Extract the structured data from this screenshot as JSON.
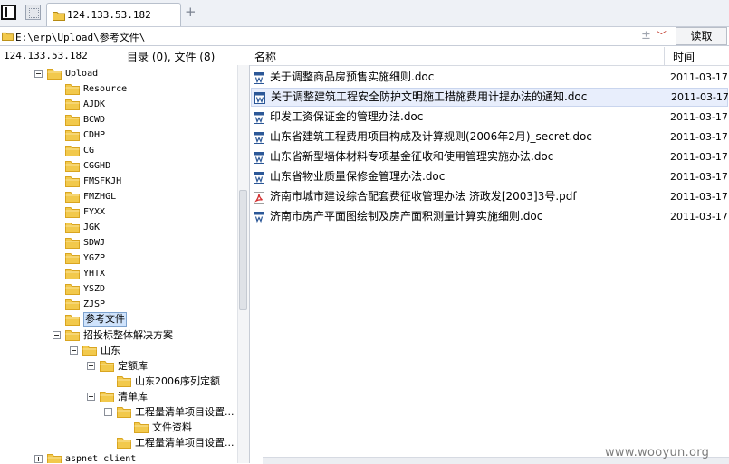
{
  "tabs": [
    {
      "label": "124.133.53.182",
      "icon": "folder-icon"
    }
  ],
  "new_tab_symbol": "+",
  "address": {
    "path": "E:\\erp\\Upload\\参考文件\\",
    "read_button": "读取"
  },
  "info": {
    "ip": "124.133.53.182",
    "summary": "目录 (0), 文件 (8)"
  },
  "columns": {
    "name": "名称",
    "time": "时间"
  },
  "tree": [
    {
      "label": "Upload",
      "depth": 0,
      "toggle": "minus",
      "mono": true
    },
    {
      "label": "Resource",
      "depth": 1,
      "mono": true
    },
    {
      "label": "AJDK",
      "depth": 1,
      "mono": true
    },
    {
      "label": "BCWD",
      "depth": 1,
      "mono": true
    },
    {
      "label": "CDHP",
      "depth": 1,
      "mono": true
    },
    {
      "label": "CG",
      "depth": 1,
      "mono": true
    },
    {
      "label": "CGGHD",
      "depth": 1,
      "mono": true
    },
    {
      "label": "FMSFKJH",
      "depth": 1,
      "mono": true
    },
    {
      "label": "FMZHGL",
      "depth": 1,
      "mono": true
    },
    {
      "label": "FYXX",
      "depth": 1,
      "mono": true
    },
    {
      "label": "JGK",
      "depth": 1,
      "mono": true
    },
    {
      "label": "SDWJ",
      "depth": 1,
      "mono": true
    },
    {
      "label": "YGZP",
      "depth": 1,
      "mono": true
    },
    {
      "label": "YHTX",
      "depth": 1,
      "mono": true
    },
    {
      "label": "YSZD",
      "depth": 1,
      "mono": true
    },
    {
      "label": "ZJSP",
      "depth": 1,
      "mono": true
    },
    {
      "label": "参考文件",
      "depth": 1,
      "selected": true
    },
    {
      "label": "招投标整体解决方案",
      "depth": 1,
      "toggle": "minus"
    },
    {
      "label": "山东",
      "depth": 2,
      "toggle": "minus"
    },
    {
      "label": "定额库",
      "depth": 3,
      "toggle": "minus"
    },
    {
      "label": "山东2006序列定额",
      "depth": 4
    },
    {
      "label": "清单库",
      "depth": 3,
      "toggle": "minus"
    },
    {
      "label": "工程量清单项目设置...",
      "depth": 4,
      "toggle": "minus"
    },
    {
      "label": "文件资料",
      "depth": 5
    },
    {
      "label": "工程量清单项目设置...",
      "depth": 4
    },
    {
      "label": "aspnet_client",
      "depth": -1,
      "toggle": "plus",
      "mono": true
    }
  ],
  "files": [
    {
      "name": "关于调整商品房预售实施细则.doc",
      "date": "2011-03-17",
      "type": "doc"
    },
    {
      "name": "关于调整建筑工程安全防护文明施工措施费用计提办法的通知.doc",
      "date": "2011-03-17",
      "type": "doc",
      "selected": true
    },
    {
      "name": "印发工资保证金的管理办法.doc",
      "date": "2011-03-17",
      "type": "doc"
    },
    {
      "name": "山东省建筑工程费用项目构成及计算规则(2006年2月)_secret.doc",
      "date": "2011-03-17",
      "type": "doc"
    },
    {
      "name": "山东省新型墙体材料专项基金征收和使用管理实施办法.doc",
      "date": "2011-03-17",
      "type": "doc"
    },
    {
      "name": "山东省物业质量保修金管理办法.doc",
      "date": "2011-03-17",
      "type": "doc"
    },
    {
      "name": "济南市城市建设综合配套费征收管理办法 济政发[2003]3号.pdf",
      "date": "2011-03-17",
      "type": "pdf"
    },
    {
      "name": "济南市房产平面图绘制及房产面积测量计算实施细则.doc",
      "date": "2011-03-17",
      "type": "doc"
    }
  ],
  "watermark": "www.wooyun.org",
  "colors": {
    "folder": "#f2c94c",
    "folder_dark": "#d9a520",
    "selected_bg": "#cfe3fc",
    "doc_icon": "#2b5797",
    "pdf_icon": "#d32f2f"
  }
}
